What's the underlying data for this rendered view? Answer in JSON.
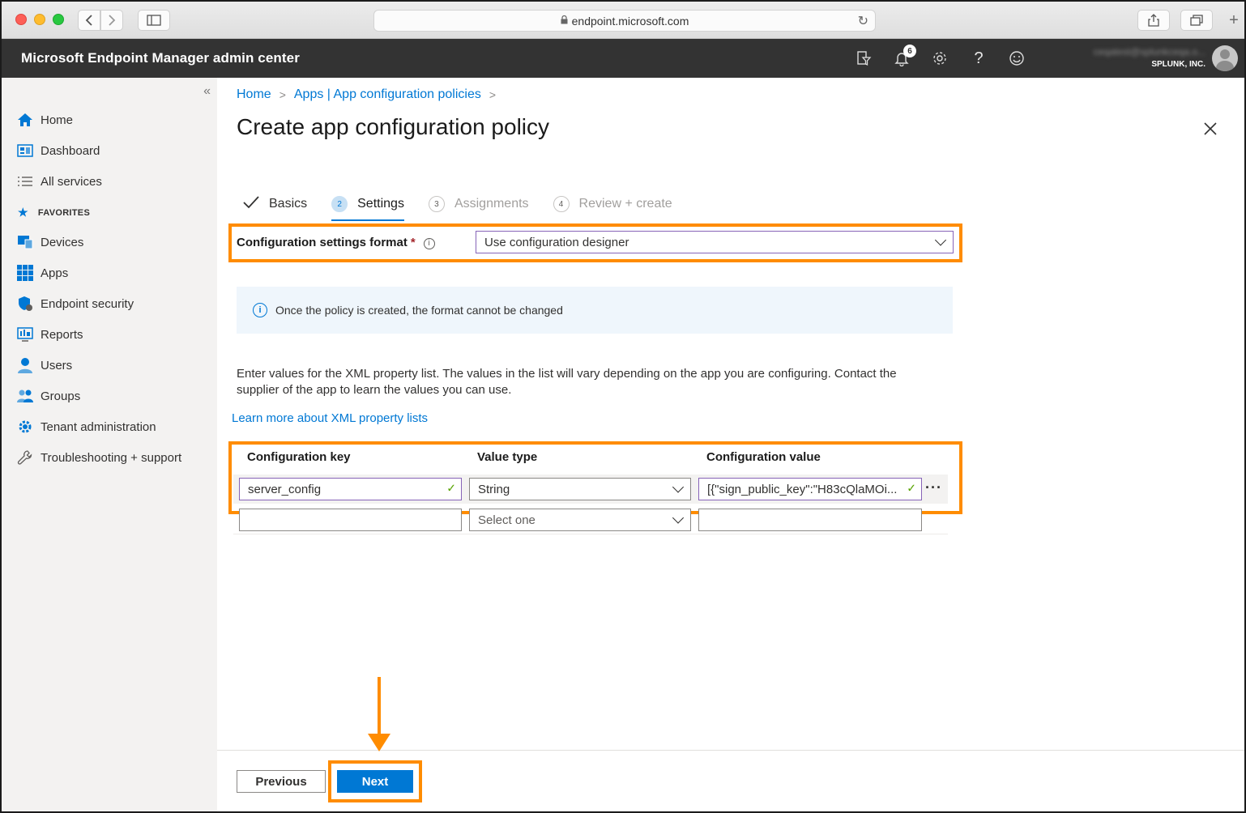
{
  "browser": {
    "url": "endpoint.microsoft.com"
  },
  "header": {
    "title": "Microsoft Endpoint Manager admin center",
    "notification_count": "6",
    "account_email": "ceqatest@splunkceqa.o...",
    "account_org": "SPLUNK, INC."
  },
  "sidebar": {
    "collapse_glyph": "«",
    "items": [
      {
        "label": "Home",
        "icon": "home-icon"
      },
      {
        "label": "Dashboard",
        "icon": "dashboard-icon"
      },
      {
        "label": "All services",
        "icon": "list-icon"
      }
    ],
    "favorites_label": "FAVORITES",
    "favorites": [
      {
        "label": "Devices",
        "icon": "devices-icon"
      },
      {
        "label": "Apps",
        "icon": "apps-grid-icon"
      },
      {
        "label": "Endpoint security",
        "icon": "shield-icon"
      },
      {
        "label": "Reports",
        "icon": "reports-icon"
      },
      {
        "label": "Users",
        "icon": "user-icon"
      },
      {
        "label": "Groups",
        "icon": "groups-icon"
      },
      {
        "label": "Tenant administration",
        "icon": "gear-icon"
      },
      {
        "label": "Troubleshooting + support",
        "icon": "wrench-icon"
      }
    ]
  },
  "breadcrumb": {
    "items": [
      "Home",
      "Apps | App configuration policies"
    ]
  },
  "page": {
    "title": "Create app configuration policy"
  },
  "wizard": {
    "steps": [
      {
        "num": "",
        "label": "Basics",
        "state": "done"
      },
      {
        "num": "2",
        "label": "Settings",
        "state": "active"
      },
      {
        "num": "3",
        "label": "Assignments",
        "state": "inactive"
      },
      {
        "num": "4",
        "label": "Review + create",
        "state": "inactive"
      }
    ]
  },
  "format": {
    "label": "Configuration settings format",
    "required_mark": "*",
    "value": "Use configuration designer"
  },
  "info": {
    "message": "Once the policy is created, the format cannot be changed"
  },
  "description": "Enter values for the XML property list. The values in the list will vary depending on the app you are configuring. Contact the supplier of the app to learn the values you can use.",
  "learn_more": "Learn more about XML property lists",
  "table": {
    "headers": [
      "Configuration key",
      "Value type",
      "Configuration value"
    ],
    "rows": [
      {
        "key": "server_config",
        "type": "String",
        "value": "[{\"sign_public_key\":\"H83cQlaMOi..."
      },
      {
        "key": "",
        "type": "Select one",
        "value": ""
      }
    ]
  },
  "footer": {
    "previous_label": "Previous",
    "next_label": "Next"
  },
  "colors": {
    "accent": "#0078d4",
    "highlight": "#ff8c00",
    "header_bg": "#333333"
  }
}
